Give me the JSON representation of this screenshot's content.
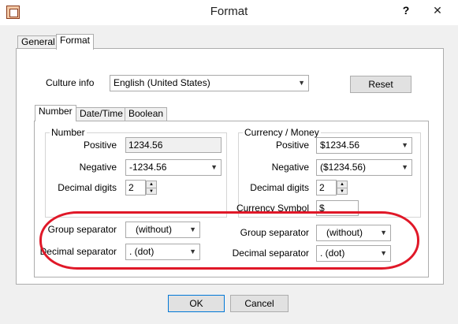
{
  "window": {
    "title": "Format",
    "help_label": "?",
    "close_label": "✕",
    "icon": "app-window-icon"
  },
  "outer_tabs": [
    {
      "label": "General",
      "active": false
    },
    {
      "label": "Format",
      "active": true
    }
  ],
  "culture": {
    "label": "Culture info",
    "value": "English (United States)",
    "reset_label": "Reset"
  },
  "inner_tabs": [
    {
      "label": "Number",
      "active": true
    },
    {
      "label": "Date/Time",
      "active": false
    },
    {
      "label": "Boolean",
      "active": false
    }
  ],
  "number_group": {
    "title": "Number",
    "positive_label": "Positive",
    "positive_value": "1234.56",
    "negative_label": "Negative",
    "negative_value": "-1234.56",
    "decimal_digits_label": "Decimal digits",
    "decimal_digits_value": "2",
    "group_separator_label": "Group separator",
    "group_separator_value": "(without)",
    "decimal_separator_label": "Decimal separator",
    "decimal_separator_value": ".  (dot)"
  },
  "currency_group": {
    "title": "Currency / Money",
    "positive_label": "Positive",
    "positive_value": "$1234.56",
    "negative_label": "Negative",
    "negative_value": "($1234.56)",
    "decimal_digits_label": "Decimal digits",
    "decimal_digits_value": "2",
    "currency_symbol_label": "Currency Symbol",
    "currency_symbol_value": "$",
    "group_separator_label": "Group separator",
    "group_separator_value": "(without)",
    "decimal_separator_label": "Decimal separator",
    "decimal_separator_value": ".  (dot)"
  },
  "footer": {
    "ok_label": "OK",
    "cancel_label": "Cancel"
  },
  "annotation": {
    "highlight_color": "#e01828"
  },
  "colors": {
    "dialog_background": "#f0f0f0",
    "panel_background": "#ffffff"
  }
}
